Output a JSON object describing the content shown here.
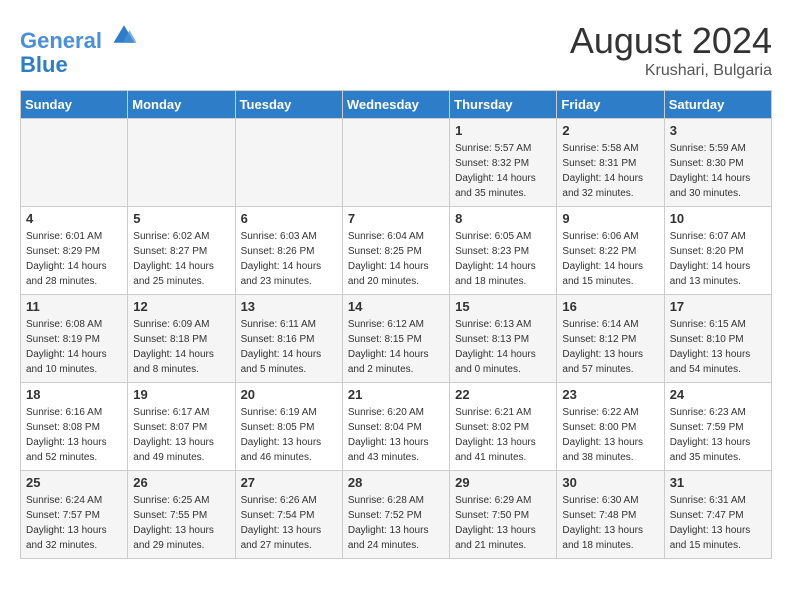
{
  "header": {
    "logo_line1": "General",
    "logo_line2": "Blue",
    "month_year": "August 2024",
    "location": "Krushari, Bulgaria"
  },
  "days_of_week": [
    "Sunday",
    "Monday",
    "Tuesday",
    "Wednesday",
    "Thursday",
    "Friday",
    "Saturday"
  ],
  "weeks": [
    [
      {
        "day": "",
        "info": ""
      },
      {
        "day": "",
        "info": ""
      },
      {
        "day": "",
        "info": ""
      },
      {
        "day": "",
        "info": ""
      },
      {
        "day": "1",
        "info": "Sunrise: 5:57 AM\nSunset: 8:32 PM\nDaylight: 14 hours\nand 35 minutes."
      },
      {
        "day": "2",
        "info": "Sunrise: 5:58 AM\nSunset: 8:31 PM\nDaylight: 14 hours\nand 32 minutes."
      },
      {
        "day": "3",
        "info": "Sunrise: 5:59 AM\nSunset: 8:30 PM\nDaylight: 14 hours\nand 30 minutes."
      }
    ],
    [
      {
        "day": "4",
        "info": "Sunrise: 6:01 AM\nSunset: 8:29 PM\nDaylight: 14 hours\nand 28 minutes."
      },
      {
        "day": "5",
        "info": "Sunrise: 6:02 AM\nSunset: 8:27 PM\nDaylight: 14 hours\nand 25 minutes."
      },
      {
        "day": "6",
        "info": "Sunrise: 6:03 AM\nSunset: 8:26 PM\nDaylight: 14 hours\nand 23 minutes."
      },
      {
        "day": "7",
        "info": "Sunrise: 6:04 AM\nSunset: 8:25 PM\nDaylight: 14 hours\nand 20 minutes."
      },
      {
        "day": "8",
        "info": "Sunrise: 6:05 AM\nSunset: 8:23 PM\nDaylight: 14 hours\nand 18 minutes."
      },
      {
        "day": "9",
        "info": "Sunrise: 6:06 AM\nSunset: 8:22 PM\nDaylight: 14 hours\nand 15 minutes."
      },
      {
        "day": "10",
        "info": "Sunrise: 6:07 AM\nSunset: 8:20 PM\nDaylight: 14 hours\nand 13 minutes."
      }
    ],
    [
      {
        "day": "11",
        "info": "Sunrise: 6:08 AM\nSunset: 8:19 PM\nDaylight: 14 hours\nand 10 minutes."
      },
      {
        "day": "12",
        "info": "Sunrise: 6:09 AM\nSunset: 8:18 PM\nDaylight: 14 hours\nand 8 minutes."
      },
      {
        "day": "13",
        "info": "Sunrise: 6:11 AM\nSunset: 8:16 PM\nDaylight: 14 hours\nand 5 minutes."
      },
      {
        "day": "14",
        "info": "Sunrise: 6:12 AM\nSunset: 8:15 PM\nDaylight: 14 hours\nand 2 minutes."
      },
      {
        "day": "15",
        "info": "Sunrise: 6:13 AM\nSunset: 8:13 PM\nDaylight: 14 hours\nand 0 minutes."
      },
      {
        "day": "16",
        "info": "Sunrise: 6:14 AM\nSunset: 8:12 PM\nDaylight: 13 hours\nand 57 minutes."
      },
      {
        "day": "17",
        "info": "Sunrise: 6:15 AM\nSunset: 8:10 PM\nDaylight: 13 hours\nand 54 minutes."
      }
    ],
    [
      {
        "day": "18",
        "info": "Sunrise: 6:16 AM\nSunset: 8:08 PM\nDaylight: 13 hours\nand 52 minutes."
      },
      {
        "day": "19",
        "info": "Sunrise: 6:17 AM\nSunset: 8:07 PM\nDaylight: 13 hours\nand 49 minutes."
      },
      {
        "day": "20",
        "info": "Sunrise: 6:19 AM\nSunset: 8:05 PM\nDaylight: 13 hours\nand 46 minutes."
      },
      {
        "day": "21",
        "info": "Sunrise: 6:20 AM\nSunset: 8:04 PM\nDaylight: 13 hours\nand 43 minutes."
      },
      {
        "day": "22",
        "info": "Sunrise: 6:21 AM\nSunset: 8:02 PM\nDaylight: 13 hours\nand 41 minutes."
      },
      {
        "day": "23",
        "info": "Sunrise: 6:22 AM\nSunset: 8:00 PM\nDaylight: 13 hours\nand 38 minutes."
      },
      {
        "day": "24",
        "info": "Sunrise: 6:23 AM\nSunset: 7:59 PM\nDaylight: 13 hours\nand 35 minutes."
      }
    ],
    [
      {
        "day": "25",
        "info": "Sunrise: 6:24 AM\nSunset: 7:57 PM\nDaylight: 13 hours\nand 32 minutes."
      },
      {
        "day": "26",
        "info": "Sunrise: 6:25 AM\nSunset: 7:55 PM\nDaylight: 13 hours\nand 29 minutes."
      },
      {
        "day": "27",
        "info": "Sunrise: 6:26 AM\nSunset: 7:54 PM\nDaylight: 13 hours\nand 27 minutes."
      },
      {
        "day": "28",
        "info": "Sunrise: 6:28 AM\nSunset: 7:52 PM\nDaylight: 13 hours\nand 24 minutes."
      },
      {
        "day": "29",
        "info": "Sunrise: 6:29 AM\nSunset: 7:50 PM\nDaylight: 13 hours\nand 21 minutes."
      },
      {
        "day": "30",
        "info": "Sunrise: 6:30 AM\nSunset: 7:48 PM\nDaylight: 13 hours\nand 18 minutes."
      },
      {
        "day": "31",
        "info": "Sunrise: 6:31 AM\nSunset: 7:47 PM\nDaylight: 13 hours\nand 15 minutes."
      }
    ]
  ]
}
